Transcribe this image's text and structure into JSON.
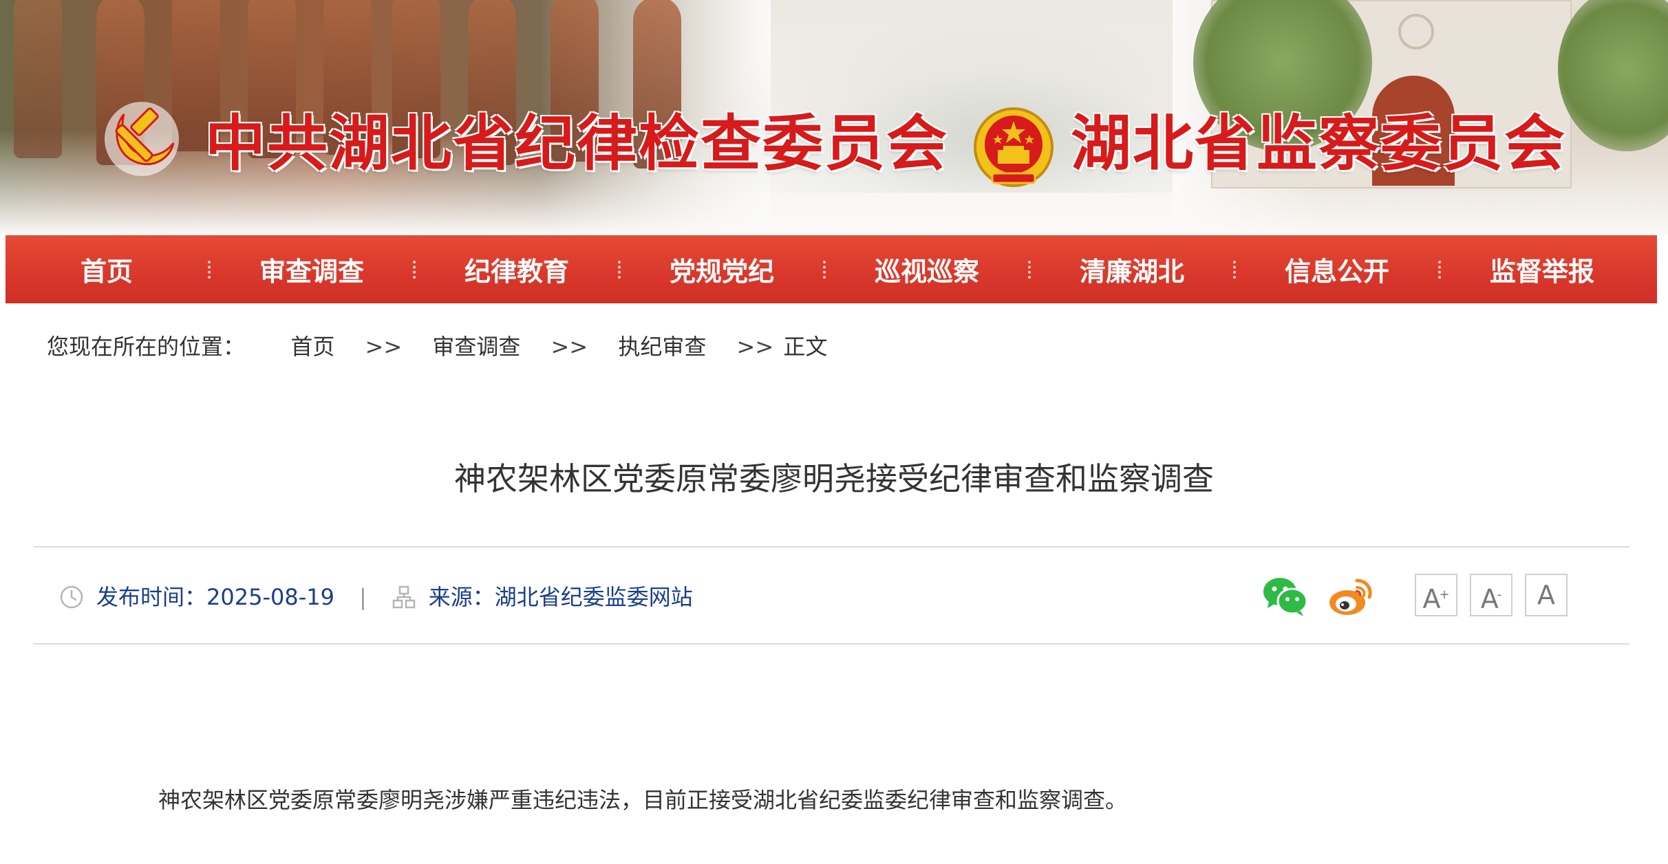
{
  "header": {
    "title_left": "中共湖北省纪律检查委员会",
    "title_right": "湖北省监察委员会",
    "emblem_left": "party-emblem",
    "emblem_right": "national-emblem",
    "title_color": "#d71a1a"
  },
  "nav": {
    "items": [
      {
        "label": "首页"
      },
      {
        "label": "审查调查"
      },
      {
        "label": "纪律教育"
      },
      {
        "label": "党规党纪"
      },
      {
        "label": "巡视巡察"
      },
      {
        "label": "清廉湖北"
      },
      {
        "label": "信息公开"
      },
      {
        "label": "监督举报"
      }
    ],
    "bg_color": "#d9372b"
  },
  "breadcrumb": {
    "prefix": "您现在所在的位置：",
    "items": [
      "首页",
      "审查调查",
      "执纪审查",
      "正文"
    ],
    "separator": ">>"
  },
  "article": {
    "title": "神农架林区党委原常委廖明尧接受纪律审查和监察调查",
    "publish_label": "发布时间：",
    "publish_date": "2025-08-19",
    "meta_divider": "|",
    "source_label": "来源：",
    "source_value": "湖北省纪委监委网站",
    "body": "神农架林区党委原常委廖明尧涉嫌严重违纪违法，目前正接受湖北省纪委监委纪律审查和监察调查。"
  },
  "toolbar": {
    "share_icons": [
      "wechat-icon",
      "weibo-icon"
    ],
    "font_buttons": [
      "A",
      "A",
      "A"
    ],
    "font_increase_mark": "+",
    "font_decrease_mark": "-"
  }
}
